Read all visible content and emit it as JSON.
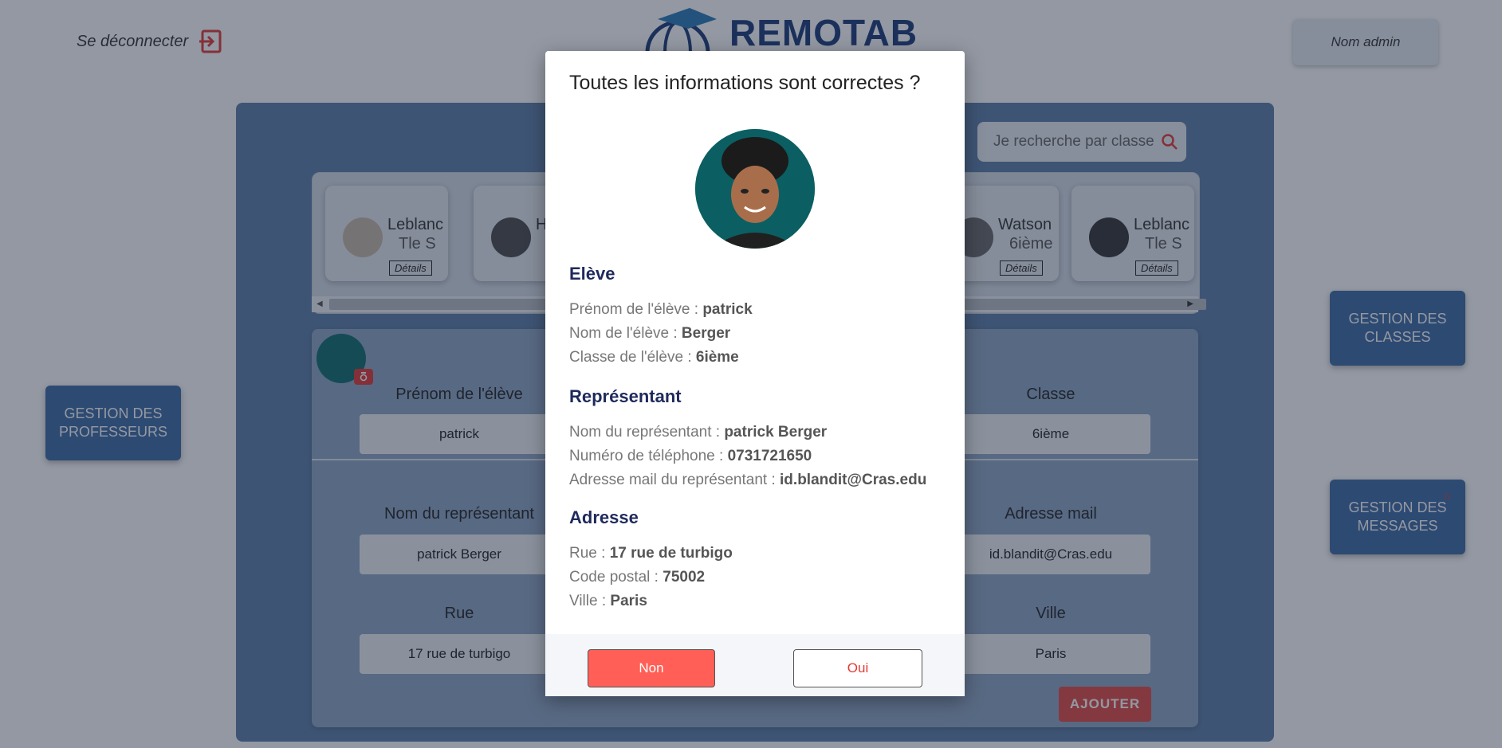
{
  "header": {
    "logout_label": "Se déconnecter",
    "logo_text": "REMOTAB",
    "admin_name": "Nom admin"
  },
  "search": {
    "placeholder": "Je recherche par classe"
  },
  "cards": [
    {
      "name": "Leblanc",
      "class": "Tle S",
      "details": "Détails"
    },
    {
      "name": "H",
      "class": "",
      "details": ""
    },
    {
      "name": "Watson",
      "class": "6ième",
      "details": "Détails"
    },
    {
      "name": "Leblanc",
      "class": "Tle S",
      "details": "Détails"
    }
  ],
  "form": {
    "first_name_label": "Prénom de l'élève",
    "first_name_value": "patrick",
    "class_label": "Classe",
    "class_value": "6ième",
    "rep_name_label": "Nom du représentant",
    "rep_name_value": "patrick Berger",
    "email_label": "Adresse mail",
    "email_value": "id.blandit@Cras.edu",
    "street_label": "Rue",
    "street_value": "17 rue de turbigo",
    "city_label": "Ville",
    "city_value": "Paris",
    "add_label": "AJOUTER"
  },
  "side": {
    "teachers": "GESTION DES PROFESSEURS",
    "classes": "GESTION DES CLASSES",
    "messages": "GESTION DES MESSAGES",
    "messages_badge": "0"
  },
  "modal": {
    "title": "Toutes les informations sont correctes ?",
    "student_heading": "Elève",
    "first_name_label": "Prénom de l'élève : ",
    "first_name_value": "patrick",
    "last_name_label": "Nom de l'élève : ",
    "last_name_value": "Berger",
    "class_label": "Classe de l'élève : ",
    "class_value": "6ième",
    "rep_heading": "Représentant",
    "rep_name_label": "Nom du représentant : ",
    "rep_name_value": "patrick Berger",
    "phone_label": "Numéro de téléphone : ",
    "phone_value": "0731721650",
    "email_label": "Adresse mail du représentant : ",
    "email_value": "id.blandit@Cras.edu",
    "address_heading": "Adresse",
    "street_label": "Rue : ",
    "street_value": "17 rue de turbigo",
    "postal_label": "Code postal : ",
    "postal_value": "75002",
    "city_label": "Ville : ",
    "city_value": "Paris",
    "no_label": "Non",
    "yes_label": "Oui"
  }
}
